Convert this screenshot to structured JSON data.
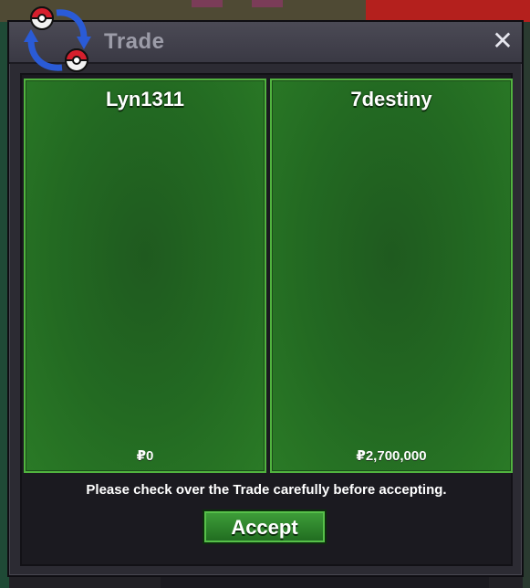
{
  "window": {
    "title": "Trade",
    "close_glyph": "✕"
  },
  "panels": {
    "left": {
      "name": "Lyn1311",
      "money_prefix": "₽",
      "money": "0"
    },
    "right": {
      "name": "7destiny",
      "money_prefix": "₽",
      "money": "2,700,000"
    }
  },
  "notice": "Please check over the Trade carefully before accepting.",
  "accept_label": "Accept",
  "icons": {
    "trade": "trade-swap-icon",
    "close": "close-icon"
  },
  "colors": {
    "panel_bg": "#236a22",
    "panel_border": "#51b33f",
    "window_bg": "#2c2b33",
    "accept_bg": "#2f8a2b"
  }
}
